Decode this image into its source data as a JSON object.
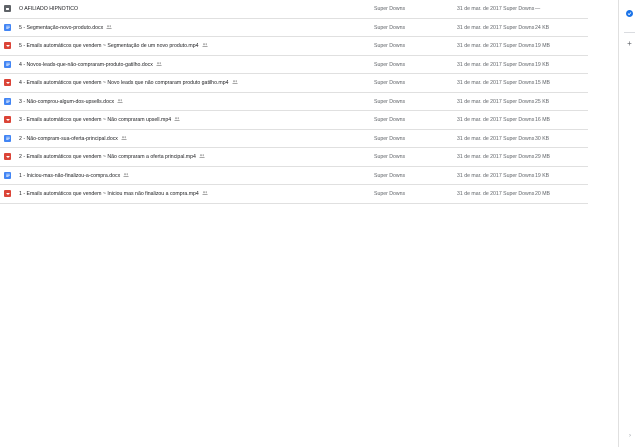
{
  "files": [
    {
      "type": "folder",
      "name": "O AFILIADO HIPNOTICO",
      "shared": false,
      "owner": "Super Downs",
      "modified": "31 de mar. de 2017 Super Downs",
      "size": "—"
    },
    {
      "type": "doc",
      "name": "5 - Segmentação-novo-produto.docx",
      "shared": true,
      "owner": "Super Downs",
      "modified": "31 de mar. de 2017 Super Downs",
      "size": "24 KB"
    },
    {
      "type": "video",
      "name": "5 - Emails automáticos que vendem ~ Segmentação de um novo produto.mp4",
      "shared": true,
      "owner": "Super Downs",
      "modified": "31 de mar. de 2017 Super Downs",
      "size": "19 MB"
    },
    {
      "type": "doc",
      "name": "4 - Novos-leads-que-não-compraram-produto-gatilho.docx",
      "shared": true,
      "owner": "Super Downs",
      "modified": "31 de mar. de 2017 Super Downs",
      "size": "19 KB"
    },
    {
      "type": "video",
      "name": "4 - Emails automáticos que vendem ~ Novo leads que não compraram produto gatilho.mp4",
      "shared": true,
      "owner": "Super Downs",
      "modified": "31 de mar. de 2017 Super Downs",
      "size": "15 MB"
    },
    {
      "type": "doc",
      "name": "3 - Não-comprou-algum-dos-upsells.docx",
      "shared": true,
      "owner": "Super Downs",
      "modified": "31 de mar. de 2017 Super Downs",
      "size": "25 KB"
    },
    {
      "type": "video",
      "name": "3 - Emails automáticos que vendem ~ Não compraram upsell.mp4",
      "shared": true,
      "owner": "Super Downs",
      "modified": "31 de mar. de 2017 Super Downs",
      "size": "16 MB"
    },
    {
      "type": "doc",
      "name": "2 - Não-compram-sua-oferta-principal.docx",
      "shared": true,
      "owner": "Super Downs",
      "modified": "31 de mar. de 2017 Super Downs",
      "size": "30 KB"
    },
    {
      "type": "video",
      "name": "2 - Emails automáticos que vendem ~ Não compraram a oferta principal.mp4",
      "shared": true,
      "owner": "Super Downs",
      "modified": "31 de mar. de 2017 Super Downs",
      "size": "29 MB"
    },
    {
      "type": "doc",
      "name": "1 - Iniciou-mas-não-finalizou-a-compra.docx",
      "shared": true,
      "owner": "Super Downs",
      "modified": "31 de mar. de 2017 Super Downs",
      "size": "19 KB"
    },
    {
      "type": "video",
      "name": "1 - Emails automáticos que vendem ~ Iniciou mas não finalizou a compra.mp4",
      "shared": true,
      "owner": "Super Downs",
      "modified": "31 de mar. de 2017 Super Downs",
      "size": "20 MB"
    }
  ],
  "icons": {
    "folder": "folder-icon",
    "doc": "google-docs-icon",
    "video": "video-file-icon",
    "shared": "shared-people-icon"
  },
  "side_panel": {
    "check_icon": "tasks-check-icon",
    "add_icon": "add-icon",
    "add_label": "+",
    "arrow_icon": "expand-panel-icon",
    "arrow_label": "›"
  },
  "colors": {
    "folder": "#5f6368",
    "doc": "#4285f4",
    "video": "#db4437",
    "accent": "#1a73e8"
  }
}
